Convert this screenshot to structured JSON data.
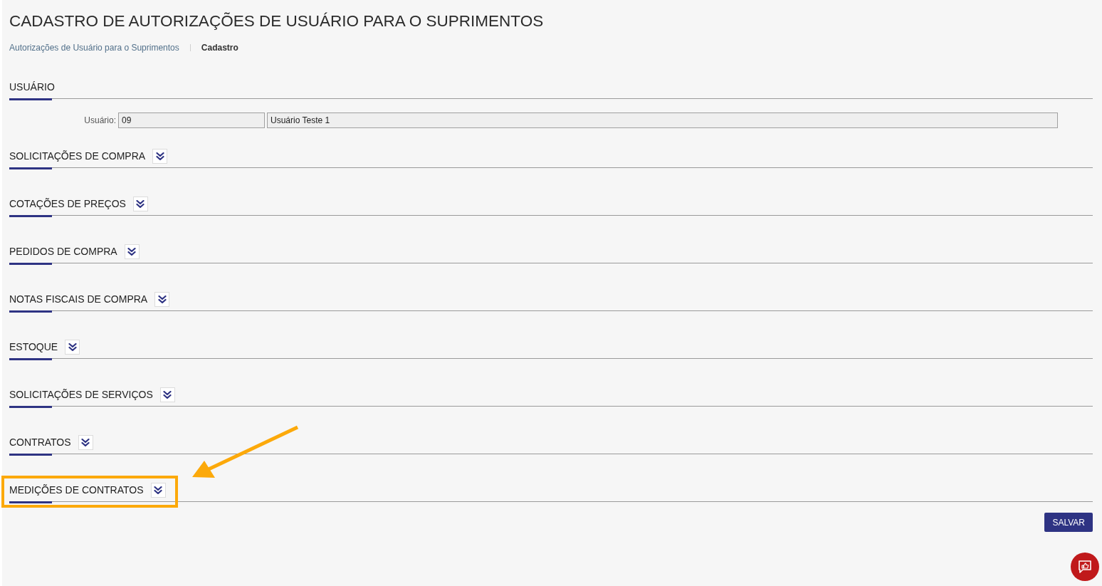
{
  "page": {
    "title": "CADASTRO DE AUTORIZAÇÕES DE USUÁRIO PARA O SUPRIMENTOS"
  },
  "breadcrumb": [
    {
      "label": "Autorizações de Usuário para o Suprimentos",
      "current": false
    },
    {
      "label": "Cadastro",
      "current": true
    }
  ],
  "user_section": {
    "title": "USUÁRIO",
    "field_label": "Usuário:",
    "code": "09",
    "name": "Usuário Teste 1"
  },
  "sections": [
    {
      "title": "SOLICITAÇÕES DE COMPRA",
      "expanded": false,
      "highlighted": false
    },
    {
      "title": "COTAÇÕES DE PREÇOS",
      "expanded": false,
      "highlighted": false
    },
    {
      "title": "PEDIDOS DE COMPRA",
      "expanded": false,
      "highlighted": false
    },
    {
      "title": "NOTAS FISCAIS DE COMPRA",
      "expanded": false,
      "highlighted": false
    },
    {
      "title": "ESTOQUE",
      "expanded": false,
      "highlighted": false
    },
    {
      "title": "SOLICITAÇÕES DE SERVIÇOS",
      "expanded": false,
      "highlighted": false
    },
    {
      "title": "CONTRATOS",
      "expanded": false,
      "highlighted": false
    },
    {
      "title": "MEDIÇÕES DE CONTRATOS",
      "expanded": false,
      "highlighted": true
    }
  ],
  "save_button": {
    "label": "SALVAR"
  }
}
